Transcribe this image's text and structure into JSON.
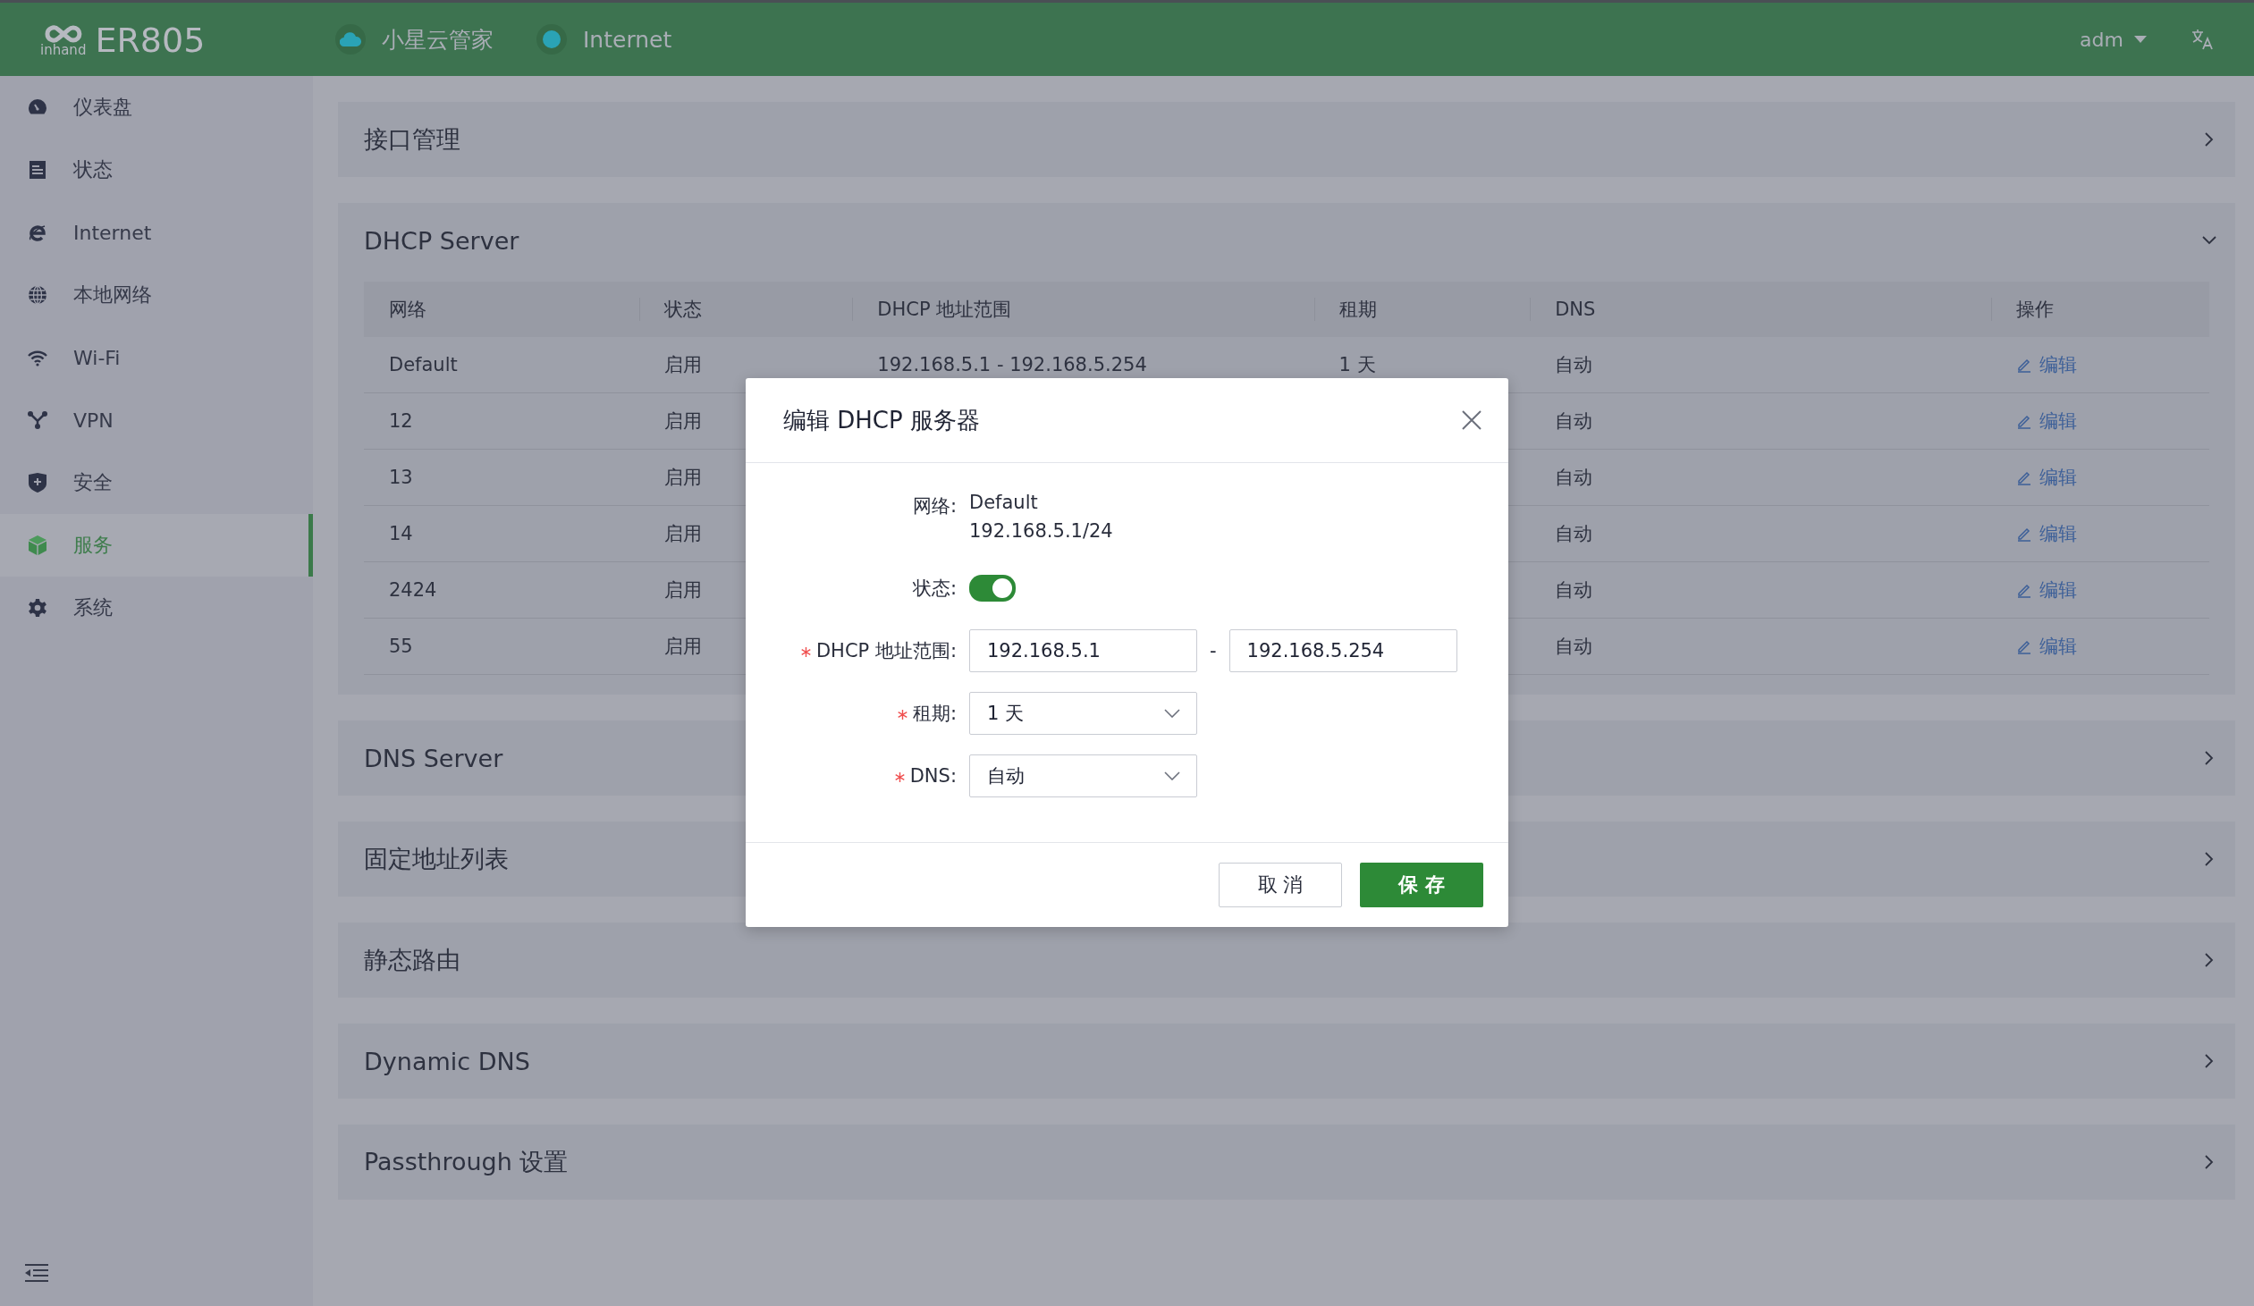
{
  "header": {
    "brand": "inhand",
    "product": "ER805",
    "cloud": "小星云管家",
    "internet": "Internet",
    "user": "adm"
  },
  "sidebar": {
    "items": [
      {
        "label": "仪表盘",
        "kind": "dashboard",
        "selected": false
      },
      {
        "label": "状态",
        "kind": "status",
        "selected": false
      },
      {
        "label": "Internet",
        "kind": "internet",
        "selected": false
      },
      {
        "label": "本地网络",
        "kind": "globe",
        "selected": false
      },
      {
        "label": "Wi-Fi",
        "kind": "wifi",
        "selected": false
      },
      {
        "label": "VPN",
        "kind": "vpn",
        "selected": false
      },
      {
        "label": "安全",
        "kind": "shield",
        "selected": false
      },
      {
        "label": "服务",
        "kind": "cube",
        "selected": true
      },
      {
        "label": "系统",
        "kind": "gear",
        "selected": false
      }
    ]
  },
  "panels": [
    {
      "title": "接口管理",
      "expanded": false
    },
    {
      "title": "DHCP Server",
      "expanded": true,
      "table": {
        "columns": [
          "网络",
          "状态",
          "DHCP 地址范围",
          "租期",
          "DNS",
          "操作"
        ],
        "rows": [
          {
            "network": "Default",
            "status": "启用",
            "range": "192.168.5.1 - 192.168.5.254",
            "lease": "1 天",
            "dns": "自动",
            "action": "编辑"
          },
          {
            "network": "12",
            "status": "启用",
            "dns": "自动",
            "action": "编辑"
          },
          {
            "network": "13",
            "status": "启用",
            "dns": "自动",
            "action": "编辑"
          },
          {
            "network": "14",
            "status": "启用",
            "dns": "自动",
            "action": "编辑"
          },
          {
            "network": "2424",
            "status": "启用",
            "dns": "自动",
            "action": "编辑"
          },
          {
            "network": "55",
            "status": "启用",
            "dns": "自动",
            "action": "编辑"
          }
        ]
      }
    },
    {
      "title": "DNS Server",
      "expanded": false
    },
    {
      "title": "固定地址列表",
      "expanded": false
    },
    {
      "title": "静态路由",
      "expanded": false
    },
    {
      "title": "Dynamic DNS",
      "expanded": false
    },
    {
      "title": "Passthrough 设置",
      "expanded": false
    }
  ],
  "dialog": {
    "title": "编辑 DHCP 服务器",
    "fields": [
      {
        "kind": "text",
        "label": "网络:",
        "required": false,
        "values": [
          "Default",
          "192.168.5.1/24"
        ]
      },
      {
        "kind": "toggle",
        "label": "状态:",
        "required": false,
        "on": true
      },
      {
        "kind": "range",
        "label": "DHCP 地址范围:",
        "required": true,
        "start": "192.168.5.1",
        "separator": "-",
        "end": "192.168.5.254"
      },
      {
        "kind": "select",
        "label": "租期:",
        "required": true,
        "value": "1 天"
      },
      {
        "kind": "select",
        "label": "DNS:",
        "required": true,
        "value": "自动"
      }
    ],
    "cancel": "取 消",
    "save": "保 存"
  }
}
